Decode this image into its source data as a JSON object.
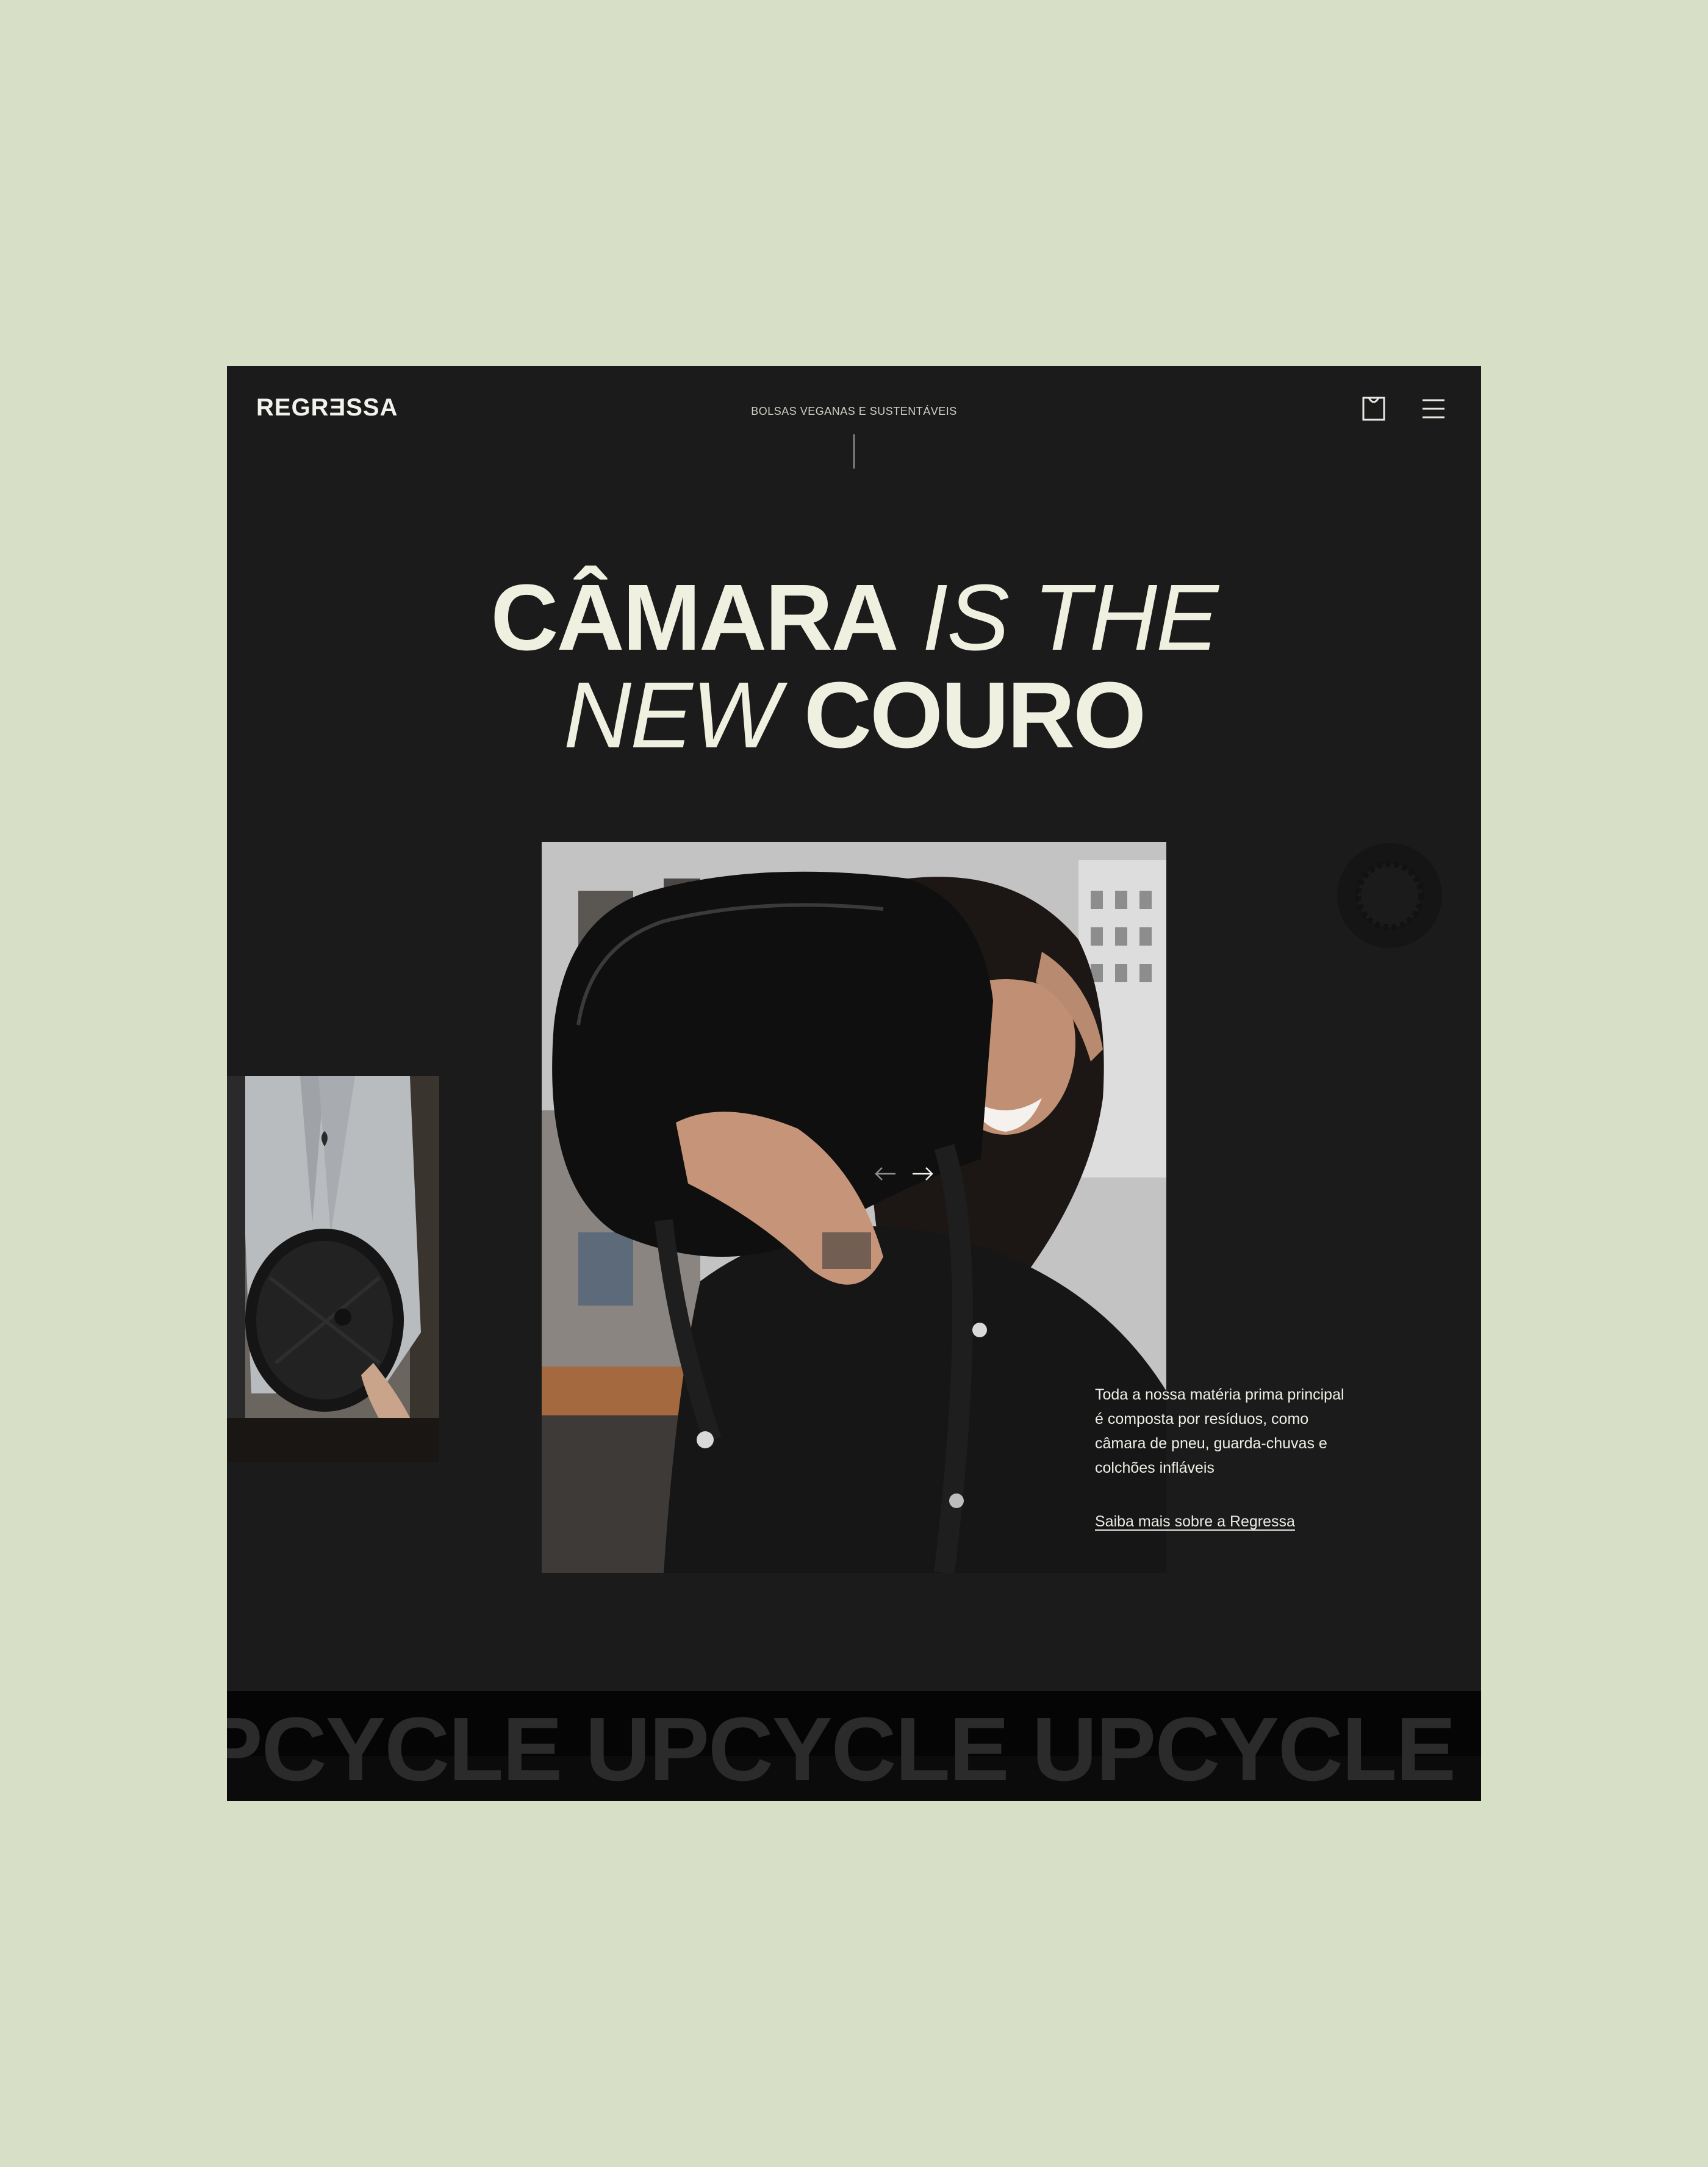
{
  "header": {
    "logo": "REGRƎSSA",
    "tagline": "BOLSAS VEGANAS E SUSTENTÁVEIS",
    "cart_icon": "shopping-bag-icon",
    "menu_icon": "hamburger-menu-icon"
  },
  "hero": {
    "line1_bold": "CÂMARA",
    "line1_italic": " IS THE",
    "line2_italic": "NEW ",
    "line2_bold": "COURO"
  },
  "carousel": {
    "prev_icon": "arrow-left-icon",
    "next_icon": "arrow-right-icon"
  },
  "info": {
    "description": "Toda a nossa matéria prima principal é composta por resíduos, como câmara de pneu, guarda-chuvas e colchões infláveis",
    "link": "Saiba mais sobre a Regressa"
  },
  "marquee": {
    "text": "PCYCLE UPCYCLE UPCYCLE UPCYCLE UPCY"
  },
  "colors": {
    "page_bg": "#d7dfc6",
    "frame_bg": "#1b1b1b",
    "headline": "#eff0e0"
  }
}
